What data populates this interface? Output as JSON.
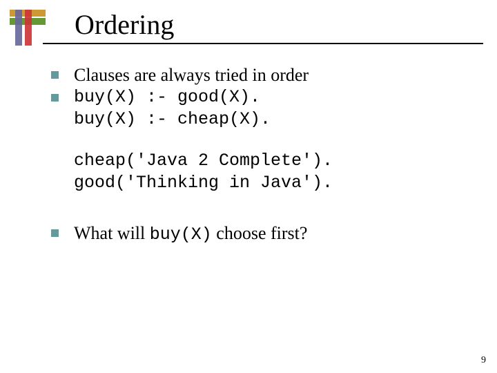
{
  "title": "Ordering",
  "bullets": {
    "b1": "Clauses are always tried in order",
    "b2_line1": "buy(X) :- good(X).",
    "b2_line2": "buy(X) :- cheap(X).",
    "fact1": "cheap('Java 2 Complete').",
    "fact2": "good('Thinking in Java').",
    "q_prefix": "What will  ",
    "q_code": "buy(X)",
    "q_suffix": "  choose first?"
  },
  "page_number": "9"
}
